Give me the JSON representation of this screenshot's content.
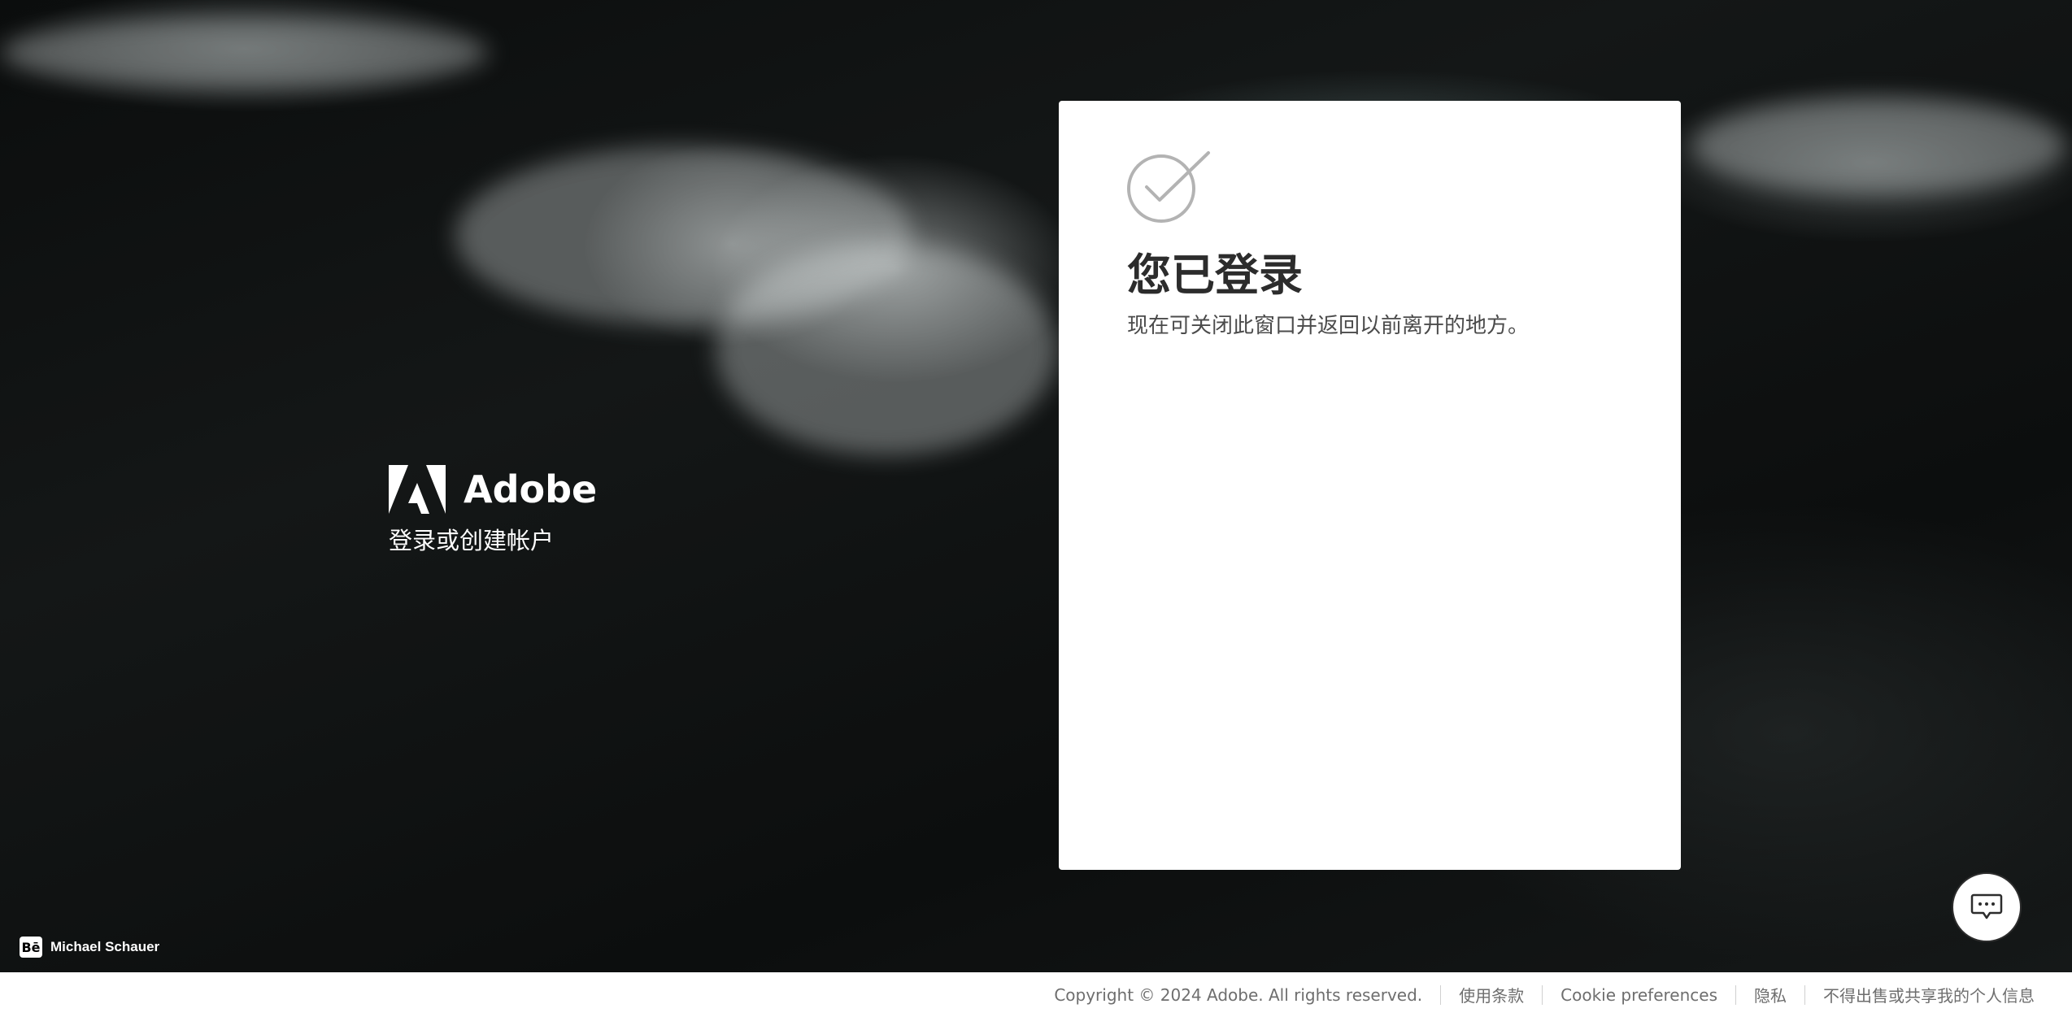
{
  "brand": {
    "name": "Adobe",
    "subtitle": "登录或创建帐户"
  },
  "card": {
    "title": "您已登录",
    "description": "现在可关闭此窗口并返回以前离开的地方。"
  },
  "credit": {
    "icon_label": "Bē",
    "author": "Michael Schauer"
  },
  "footer": {
    "copyright": "Copyright © 2024 Adobe. All rights reserved.",
    "links": [
      "使用条款",
      "Cookie preferences",
      "隐私",
      "不得出售或共享我的个人信息"
    ]
  },
  "colors": {
    "card_background": "#ffffff",
    "check_icon": "#b3b3b3",
    "footer_text": "#6e6e6e"
  }
}
